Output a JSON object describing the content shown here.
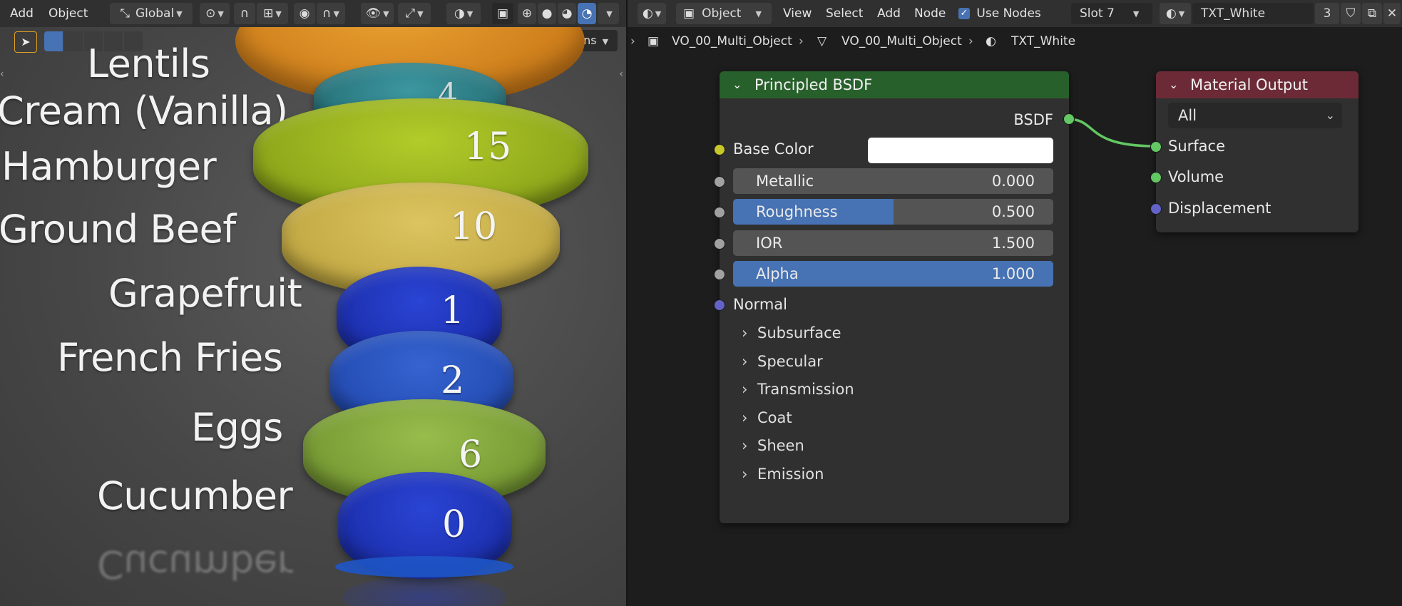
{
  "viewport_header": {
    "menu_add": "Add",
    "menu_object": "Object",
    "orientation": "Global",
    "options": "Options"
  },
  "node_header": {
    "mode": "Object",
    "menu_view": "View",
    "menu_select": "Select",
    "menu_add": "Add",
    "menu_node": "Node",
    "use_nodes_label": "Use Nodes",
    "use_nodes_checked": true,
    "slot": "Slot 7",
    "material_name": "TXT_White",
    "user_count": "3"
  },
  "breadcrumb": {
    "object": "VO_00_Multi_Object",
    "mesh": "VO_00_Multi_Object",
    "material": "TXT_White"
  },
  "scene": {
    "labels": [
      "Lentils",
      "Cream (Vanilla)",
      "Hamburger",
      "Ground Beef",
      "Grapefruit",
      "French Fries",
      "Eggs",
      "Cucumber"
    ],
    "values": [
      "4",
      "15",
      "10",
      "1",
      "2",
      "6",
      "0"
    ],
    "colors": {
      "orange": "#d98a1e",
      "teal": "#2f7f86",
      "lime": "#9bb51f",
      "khaki": "#cbb34f",
      "blue": "#1f36c2",
      "mid_blue": "#2850c0",
      "green": "#86ab3e"
    }
  },
  "principled": {
    "title": "Principled BSDF",
    "output": "BSDF",
    "base_color_label": "Base Color",
    "base_color": "#ffffff",
    "fields": [
      {
        "label": "Metallic",
        "value": "0.000",
        "fraction": 0.0
      },
      {
        "label": "Roughness",
        "value": "0.500",
        "fraction": 0.5
      },
      {
        "label": "IOR",
        "value": "1.500",
        "fraction": 0.0
      },
      {
        "label": "Alpha",
        "value": "1.000",
        "fraction": 1.0
      }
    ],
    "normal_label": "Normal",
    "panels": [
      "Subsurface",
      "Specular",
      "Transmission",
      "Coat",
      "Sheen",
      "Emission"
    ]
  },
  "material_output": {
    "title": "Material Output",
    "target": "All",
    "inputs": [
      "Surface",
      "Volume",
      "Displacement"
    ]
  },
  "colors": {
    "header_bg": "#303030",
    "accent_blue": "#4772b3",
    "shader_header": "#28602b",
    "output_header": "#6c2a37",
    "socket_green": "#63c763",
    "socket_yellow": "#c7c729",
    "socket_grey": "#a1a1a1",
    "socket_purple": "#6363c7",
    "link_green": "#63c763"
  }
}
